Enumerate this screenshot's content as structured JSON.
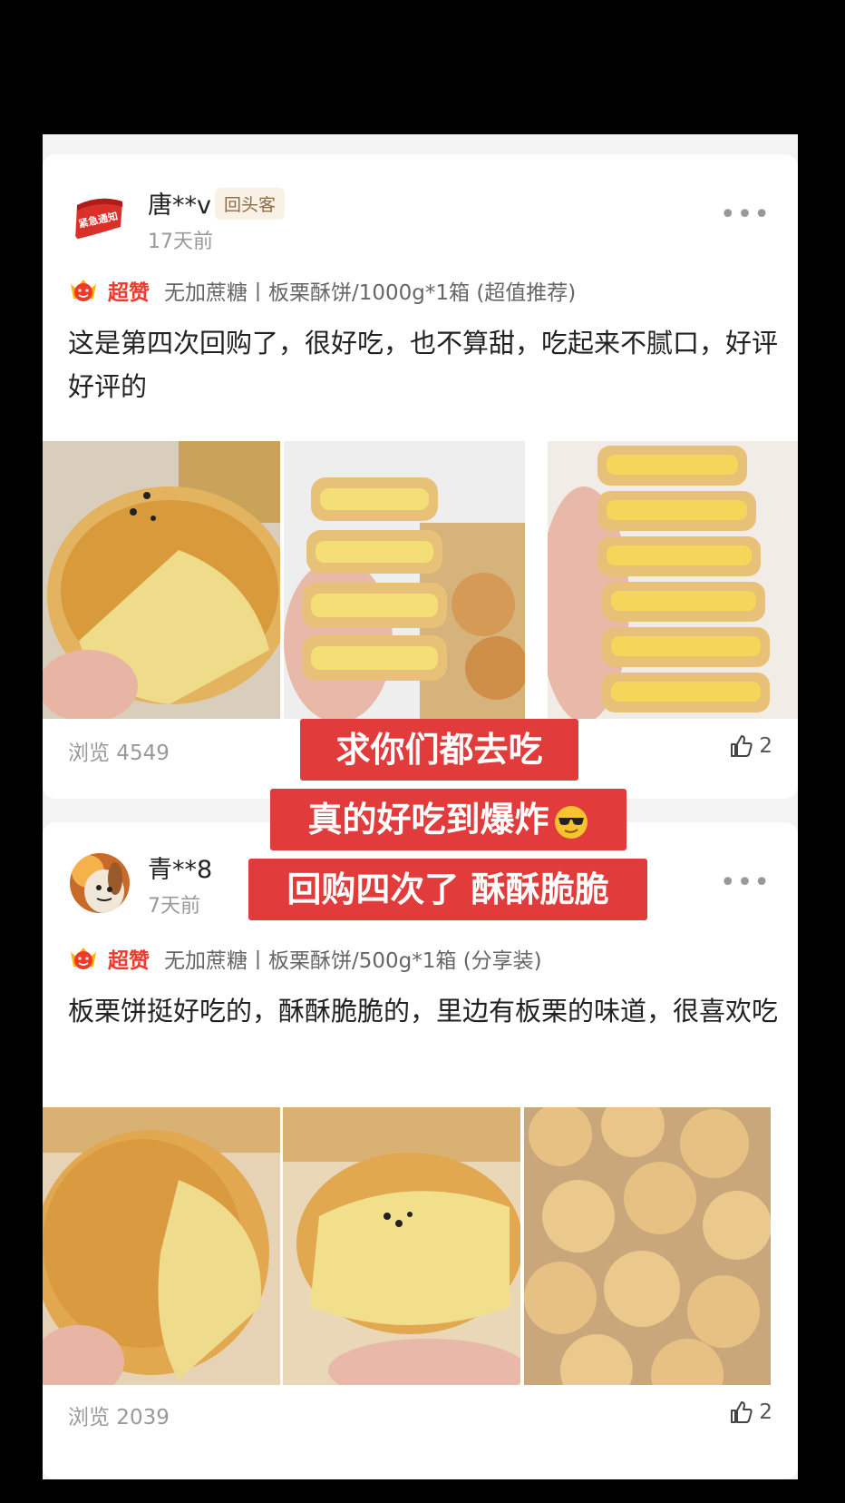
{
  "reviews": [
    {
      "username": "唐**v",
      "badge": "回头客",
      "time_ago": "17天前",
      "rating_label": "超赞",
      "product": "无加蔗糖丨板栗酥饼/1000g*1箱 (超值推荐)",
      "comment": "这是第四次回购了，很好吃，也不算甜，吃起来不腻口，好评好评的",
      "avatar_text": "紧急通知",
      "views": "浏览 4549",
      "likes": "2"
    },
    {
      "username": "青**8",
      "time_ago": "7天前",
      "rating_label": "超赞",
      "product": "无加蔗糖丨板栗酥饼/500g*1箱 (分享装)",
      "comment": "板栗饼挺好吃的，酥酥脆脆的，里边有板栗的味道，很喜欢吃",
      "views": "浏览 2039",
      "likes": "2"
    }
  ],
  "overlay_captions": [
    "求你们都去吃",
    "真的好吃到爆炸",
    "回购四次了 酥酥脆脆"
  ],
  "icons": {
    "more": "more-horizontal-icon",
    "like": "thumbs-up-icon",
    "rating": "crown-face-icon",
    "emoji": "sunglasses-emoji-icon"
  },
  "colors": {
    "accent": "#f0392b",
    "overlay_bg": "#e23b3b",
    "badge_bg": "#faf1e6"
  }
}
